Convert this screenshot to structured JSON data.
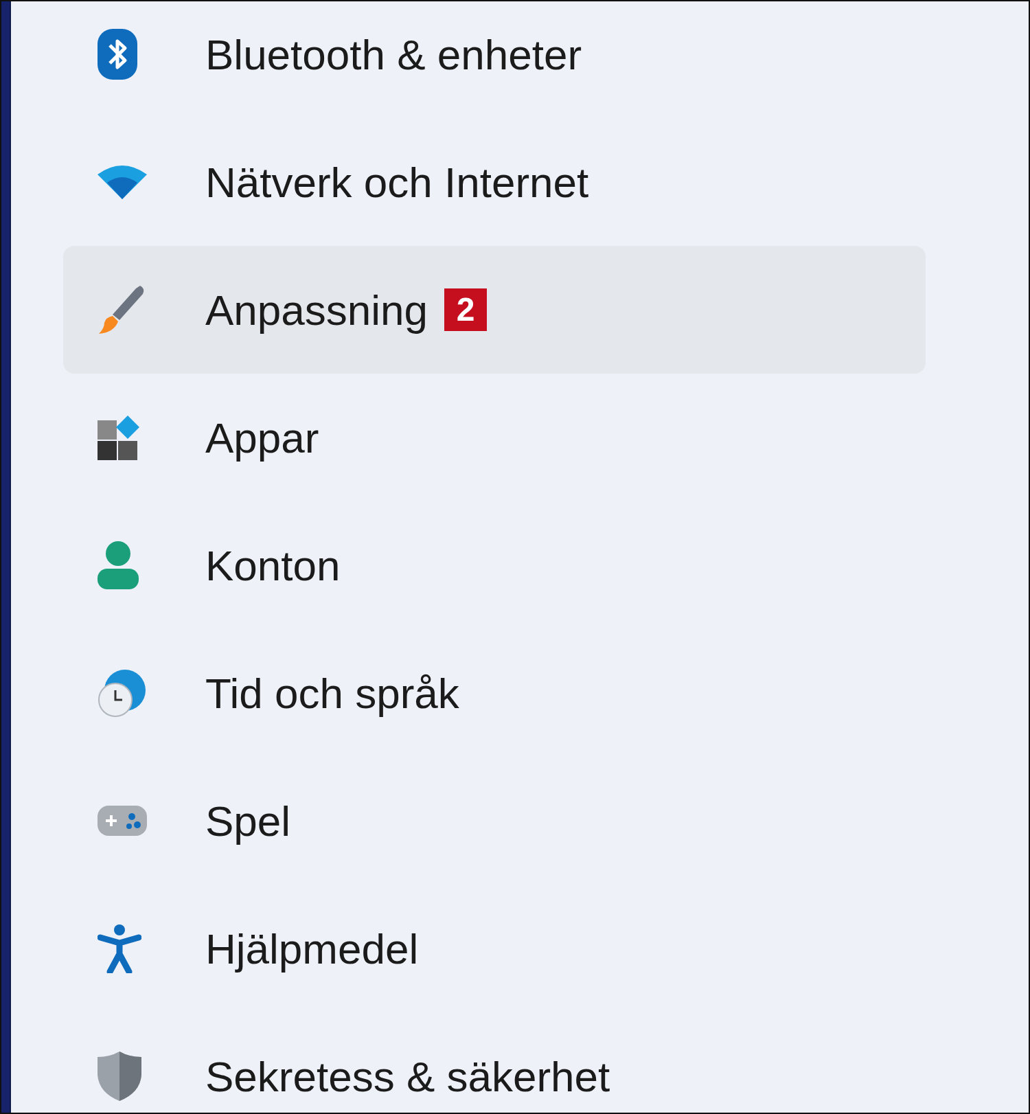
{
  "nav_items": [
    {
      "label": "Bluetooth & enheter",
      "selected": false
    },
    {
      "label": "Nätverk och Internet",
      "selected": false
    },
    {
      "label": "Anpassning",
      "selected": true,
      "badge": "2"
    },
    {
      "label": "Appar",
      "selected": false
    },
    {
      "label": "Konton",
      "selected": false
    },
    {
      "label": "Tid och språk",
      "selected": false
    },
    {
      "label": "Spel",
      "selected": false
    },
    {
      "label": "Hjälpmedel",
      "selected": false
    },
    {
      "label": "Sekretess & säkerhet",
      "selected": false
    }
  ]
}
